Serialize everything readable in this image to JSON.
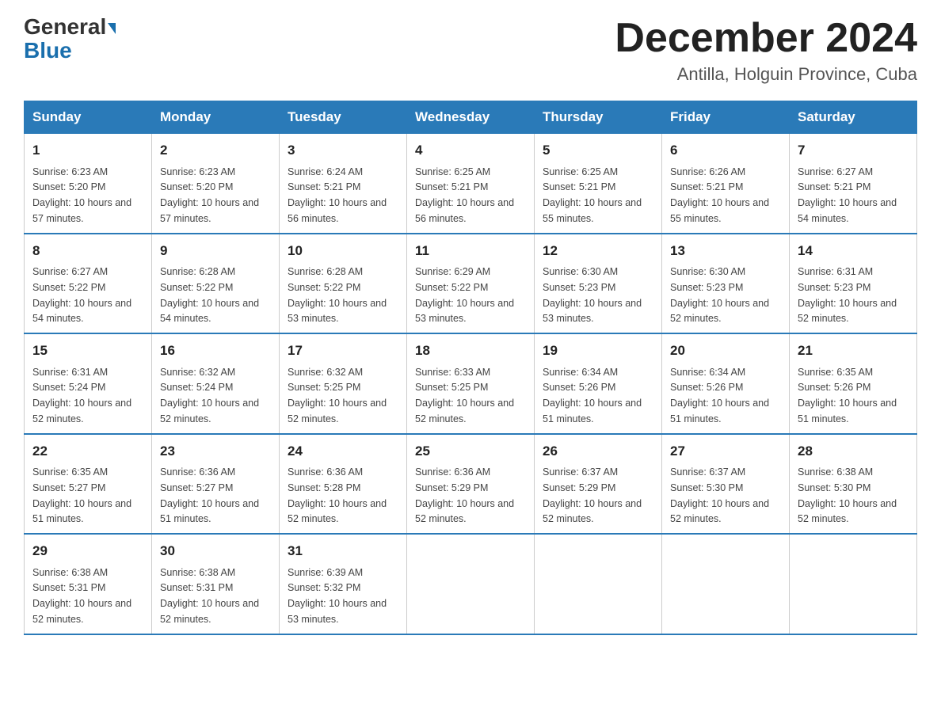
{
  "logo": {
    "general": "General",
    "blue": "Blue"
  },
  "title": "December 2024",
  "subtitle": "Antilla, Holguin Province, Cuba",
  "days_of_week": [
    "Sunday",
    "Monday",
    "Tuesday",
    "Wednesday",
    "Thursday",
    "Friday",
    "Saturday"
  ],
  "weeks": [
    [
      {
        "day": "1",
        "sunrise": "6:23 AM",
        "sunset": "5:20 PM",
        "daylight": "10 hours and 57 minutes."
      },
      {
        "day": "2",
        "sunrise": "6:23 AM",
        "sunset": "5:20 PM",
        "daylight": "10 hours and 57 minutes."
      },
      {
        "day": "3",
        "sunrise": "6:24 AM",
        "sunset": "5:21 PM",
        "daylight": "10 hours and 56 minutes."
      },
      {
        "day": "4",
        "sunrise": "6:25 AM",
        "sunset": "5:21 PM",
        "daylight": "10 hours and 56 minutes."
      },
      {
        "day": "5",
        "sunrise": "6:25 AM",
        "sunset": "5:21 PM",
        "daylight": "10 hours and 55 minutes."
      },
      {
        "day": "6",
        "sunrise": "6:26 AM",
        "sunset": "5:21 PM",
        "daylight": "10 hours and 55 minutes."
      },
      {
        "day": "7",
        "sunrise": "6:27 AM",
        "sunset": "5:21 PM",
        "daylight": "10 hours and 54 minutes."
      }
    ],
    [
      {
        "day": "8",
        "sunrise": "6:27 AM",
        "sunset": "5:22 PM",
        "daylight": "10 hours and 54 minutes."
      },
      {
        "day": "9",
        "sunrise": "6:28 AM",
        "sunset": "5:22 PM",
        "daylight": "10 hours and 54 minutes."
      },
      {
        "day": "10",
        "sunrise": "6:28 AM",
        "sunset": "5:22 PM",
        "daylight": "10 hours and 53 minutes."
      },
      {
        "day": "11",
        "sunrise": "6:29 AM",
        "sunset": "5:22 PM",
        "daylight": "10 hours and 53 minutes."
      },
      {
        "day": "12",
        "sunrise": "6:30 AM",
        "sunset": "5:23 PM",
        "daylight": "10 hours and 53 minutes."
      },
      {
        "day": "13",
        "sunrise": "6:30 AM",
        "sunset": "5:23 PM",
        "daylight": "10 hours and 52 minutes."
      },
      {
        "day": "14",
        "sunrise": "6:31 AM",
        "sunset": "5:23 PM",
        "daylight": "10 hours and 52 minutes."
      }
    ],
    [
      {
        "day": "15",
        "sunrise": "6:31 AM",
        "sunset": "5:24 PM",
        "daylight": "10 hours and 52 minutes."
      },
      {
        "day": "16",
        "sunrise": "6:32 AM",
        "sunset": "5:24 PM",
        "daylight": "10 hours and 52 minutes."
      },
      {
        "day": "17",
        "sunrise": "6:32 AM",
        "sunset": "5:25 PM",
        "daylight": "10 hours and 52 minutes."
      },
      {
        "day": "18",
        "sunrise": "6:33 AM",
        "sunset": "5:25 PM",
        "daylight": "10 hours and 52 minutes."
      },
      {
        "day": "19",
        "sunrise": "6:34 AM",
        "sunset": "5:26 PM",
        "daylight": "10 hours and 51 minutes."
      },
      {
        "day": "20",
        "sunrise": "6:34 AM",
        "sunset": "5:26 PM",
        "daylight": "10 hours and 51 minutes."
      },
      {
        "day": "21",
        "sunrise": "6:35 AM",
        "sunset": "5:26 PM",
        "daylight": "10 hours and 51 minutes."
      }
    ],
    [
      {
        "day": "22",
        "sunrise": "6:35 AM",
        "sunset": "5:27 PM",
        "daylight": "10 hours and 51 minutes."
      },
      {
        "day": "23",
        "sunrise": "6:36 AM",
        "sunset": "5:27 PM",
        "daylight": "10 hours and 51 minutes."
      },
      {
        "day": "24",
        "sunrise": "6:36 AM",
        "sunset": "5:28 PM",
        "daylight": "10 hours and 52 minutes."
      },
      {
        "day": "25",
        "sunrise": "6:36 AM",
        "sunset": "5:29 PM",
        "daylight": "10 hours and 52 minutes."
      },
      {
        "day": "26",
        "sunrise": "6:37 AM",
        "sunset": "5:29 PM",
        "daylight": "10 hours and 52 minutes."
      },
      {
        "day": "27",
        "sunrise": "6:37 AM",
        "sunset": "5:30 PM",
        "daylight": "10 hours and 52 minutes."
      },
      {
        "day": "28",
        "sunrise": "6:38 AM",
        "sunset": "5:30 PM",
        "daylight": "10 hours and 52 minutes."
      }
    ],
    [
      {
        "day": "29",
        "sunrise": "6:38 AM",
        "sunset": "5:31 PM",
        "daylight": "10 hours and 52 minutes."
      },
      {
        "day": "30",
        "sunrise": "6:38 AM",
        "sunset": "5:31 PM",
        "daylight": "10 hours and 52 minutes."
      },
      {
        "day": "31",
        "sunrise": "6:39 AM",
        "sunset": "5:32 PM",
        "daylight": "10 hours and 53 minutes."
      },
      null,
      null,
      null,
      null
    ]
  ]
}
